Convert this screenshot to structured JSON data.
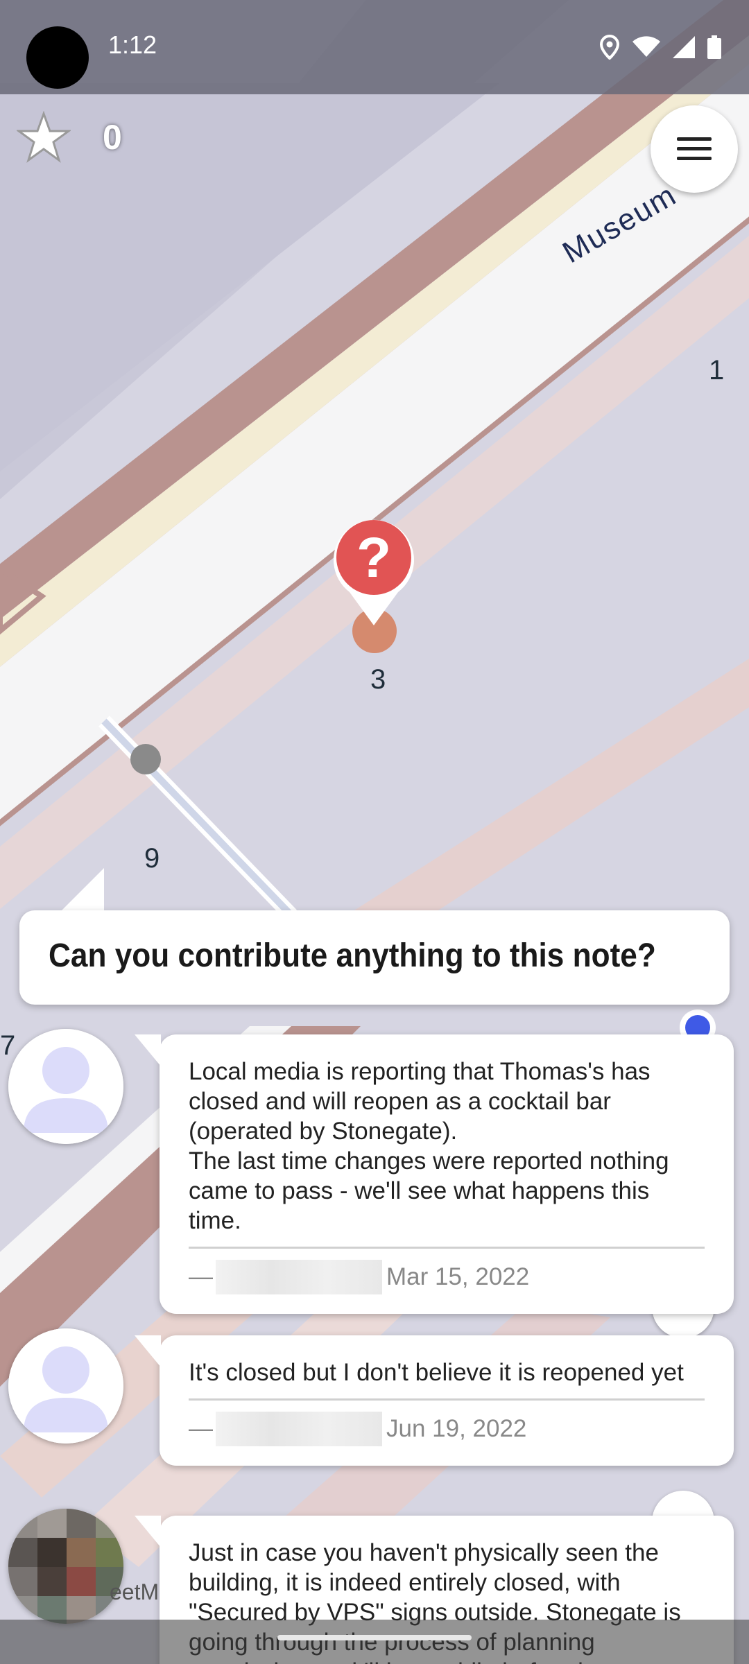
{
  "status_bar": {
    "time": "1:12",
    "icons": [
      "location-icon",
      "wifi-icon",
      "signal-icon",
      "battery-icon"
    ]
  },
  "top": {
    "star_count": "0",
    "menu_icon": "hamburger-menu-icon"
  },
  "map": {
    "street_label": "Museum",
    "house_numbers": [
      "1",
      "3",
      "9",
      "7"
    ],
    "marker_icon": "question-marker-icon",
    "partial_label": "eetM"
  },
  "quest": {
    "question": "Can you contribute anything to this note?"
  },
  "comments": [
    {
      "text": "Local media is reporting that Thomas's has closed and will reopen as a cocktail bar (operated by Stonegate).\nThe last time changes were reported nothing came to pass - we'll see what happens this time.",
      "dash": "—",
      "date": "Mar 15, 2022",
      "avatar": "default-avatar-icon"
    },
    {
      "text": "It's closed but I don't believe it is reopened yet",
      "dash": "—",
      "date": "Jun 19, 2022",
      "avatar": "default-avatar-icon"
    },
    {
      "text": "Just in case you haven't physically seen the building, it is indeed entirely closed, with \"Secured by VPS\" signs outside. Stonegate is going through the process of planning permission, so it'll be a while before it",
      "avatar": "user-photo-avatar"
    }
  ],
  "colors": {
    "marker": "#e15454",
    "avatar_silhouette": "#dcdcfa",
    "map_road": "#f7f7f7",
    "map_outline": "#a8817e"
  }
}
